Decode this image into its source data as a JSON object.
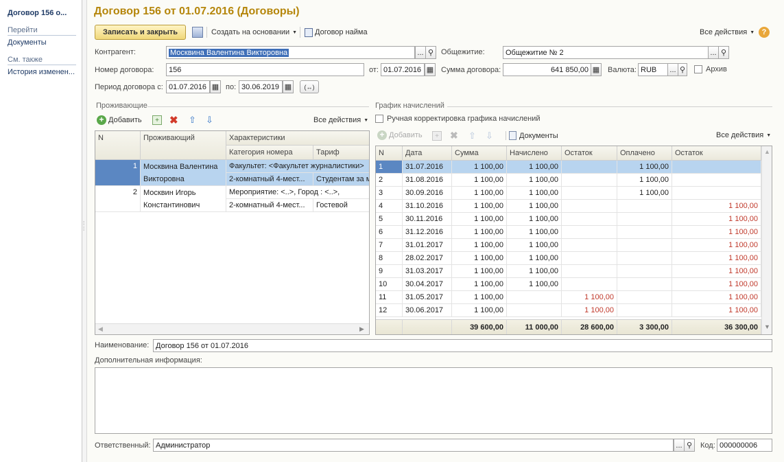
{
  "sidebar": {
    "title": "Договор 156 о...",
    "goto_header": "Перейти",
    "goto_items": [
      "Документы"
    ],
    "see_also_header": "См. также",
    "see_also_items": [
      "История изменен..."
    ]
  },
  "form": {
    "title": "Договор 156 от 01.07.2016 (Договоры)",
    "toolbar": {
      "save_close": "Записать и закрыть",
      "create_based": "Создать на основании",
      "contract_doc": "Договор найма",
      "all_actions": "Все действия",
      "help": "?"
    },
    "counterparty_label": "Контрагент:",
    "counterparty_value": "Москвина Валентина Викторовна",
    "hostel_label": "Общежитие:",
    "hostel_value": "Общежитие № 2",
    "contract_no_label": "Номер договора:",
    "contract_no_value": "156",
    "from_label": "от:",
    "from_value": "01.07.2016",
    "sum_label": "Сумма договора:",
    "sum_value": "641 850,00",
    "currency_label": "Валюта:",
    "currency_value": "RUB",
    "archive_label": "Архив",
    "period_label": "Период договора с:",
    "period_from": "01.07.2016",
    "period_to_label": "по:",
    "period_to": "30.06.2019",
    "period_btn": "(↔)",
    "ellipsis": "...",
    "name_label": "Наименование:",
    "name_value": "Договор 156 от 01.07.2016",
    "extra_label": "Дополнительная информация:",
    "resp_label": "Ответственный:",
    "resp_value": "Администратор",
    "code_label": "Код:",
    "code_value": "000000006"
  },
  "residents": {
    "section": "Проживающие",
    "add": "Добавить",
    "all_actions": "Все действия",
    "headers": {
      "n": "N",
      "resident": "Проживающий",
      "chars": "Характеристики",
      "room_cat": "Категория номера",
      "tariff": "Тариф"
    },
    "rows": [
      {
        "n": "1",
        "name1": "Москвина Валентина",
        "name2": "Викторовна",
        "char1": "Факультет: <Факультет журналистики>",
        "room": "2-комнатный 4-мест...",
        "tariff": "Студентам за м"
      },
      {
        "n": "2",
        "name1": "Москвин Игорь",
        "name2": "Константинович",
        "char1": "Мероприятие: <..>, Город : <..>,",
        "room": "2-комнатный 4-мест...",
        "tariff": "Гостевой"
      }
    ]
  },
  "schedule": {
    "section": "График начислений",
    "manual_label": "Ручная корректировка графика начислений",
    "add": "Добавить",
    "documents": "Документы",
    "all_actions": "Все действия",
    "headers": [
      "N",
      "Дата",
      "Сумма",
      "Начислено",
      "Остаток",
      "Оплачено",
      "Остаток"
    ],
    "rows": [
      [
        "1",
        "31.07.2016",
        "1 100,00",
        "1 100,00",
        "",
        "1 100,00",
        ""
      ],
      [
        "2",
        "31.08.2016",
        "1 100,00",
        "1 100,00",
        "",
        "1 100,00",
        ""
      ],
      [
        "3",
        "30.09.2016",
        "1 100,00",
        "1 100,00",
        "",
        "1 100,00",
        ""
      ],
      [
        "4",
        "31.10.2016",
        "1 100,00",
        "1 100,00",
        "",
        "",
        "1 100,00"
      ],
      [
        "5",
        "30.11.2016",
        "1 100,00",
        "1 100,00",
        "",
        "",
        "1 100,00"
      ],
      [
        "6",
        "31.12.2016",
        "1 100,00",
        "1 100,00",
        "",
        "",
        "1 100,00"
      ],
      [
        "7",
        "31.01.2017",
        "1 100,00",
        "1 100,00",
        "",
        "",
        "1 100,00"
      ],
      [
        "8",
        "28.02.2017",
        "1 100,00",
        "1 100,00",
        "",
        "",
        "1 100,00"
      ],
      [
        "9",
        "31.03.2017",
        "1 100,00",
        "1 100,00",
        "",
        "",
        "1 100,00"
      ],
      [
        "10",
        "30.04.2017",
        "1 100,00",
        "1 100,00",
        "",
        "",
        "1 100,00"
      ],
      [
        "11",
        "31.05.2017",
        "1 100,00",
        "",
        "1 100,00",
        "",
        "1 100,00"
      ],
      [
        "12",
        "30.06.2017",
        "1 100,00",
        "",
        "1 100,00",
        "",
        "1 100,00"
      ]
    ],
    "totals": [
      "",
      "",
      "39 600,00",
      "11 000,00",
      "28 600,00",
      "3 300,00",
      "36 300,00"
    ],
    "negative_color": "#c0392b"
  }
}
